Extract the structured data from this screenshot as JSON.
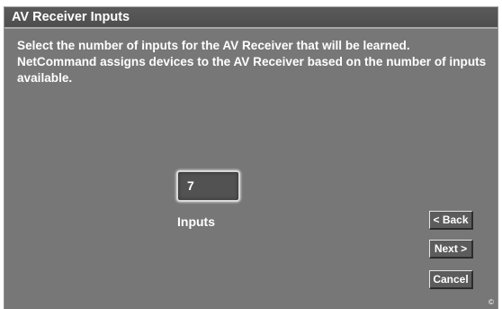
{
  "window": {
    "title": "AV Receiver Inputs"
  },
  "main": {
    "instructions": "Select the number of inputs for the AV Receiver that will be learned. NetCommand assigns devices to the AV Receiver based on the number of inputs available.",
    "inputs_field": {
      "value": "7",
      "label": "Inputs"
    }
  },
  "buttons": {
    "back": "< Back",
    "next": "Next >",
    "cancel": "Cancel"
  },
  "footer": {
    "mark": "©"
  },
  "colors": {
    "background": "#777777",
    "title_bar": "#525252",
    "text": "#ffffff",
    "button_face": "#5c5c5c"
  }
}
